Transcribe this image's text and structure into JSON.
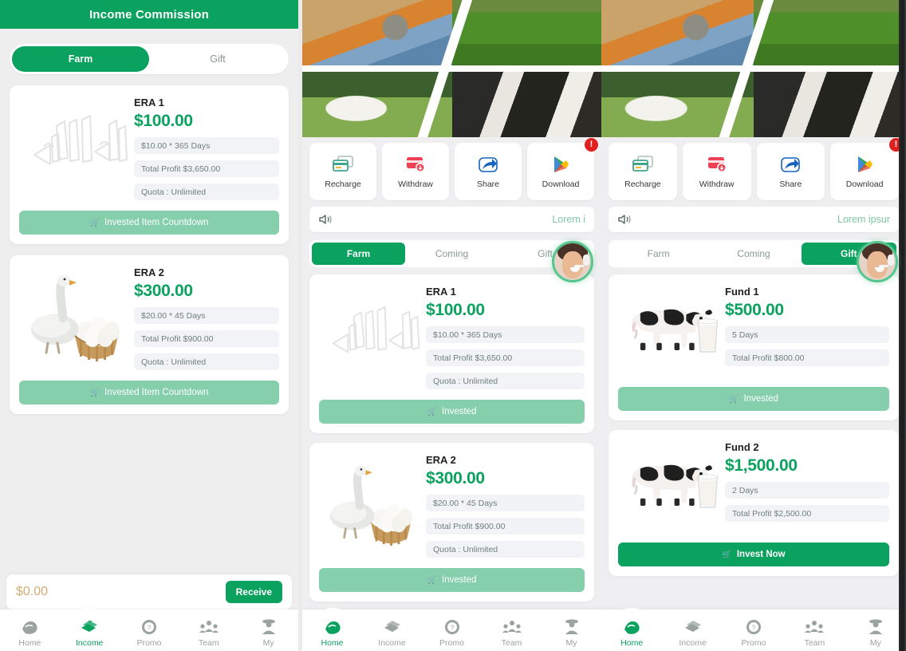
{
  "app": {
    "accent_green": "#0ba15e",
    "muted_green": "#85cfac",
    "gold": "#d2ab73",
    "badge_red": "#e01f1f"
  },
  "left_panel": {
    "header_title": "Income Commission",
    "segments": [
      {
        "label": "Farm",
        "active": true
      },
      {
        "label": "Gift",
        "active": false
      }
    ],
    "cards": [
      {
        "title": "ERA 1",
        "price": "$100.00",
        "meta": [
          "$10.00 * 365 Days",
          "Total Profit $3,650.00",
          "Quota : Unlimited"
        ],
        "cta_label": "Invested Item Countdown",
        "cta_state": "disabled",
        "art": "sketch-doodle"
      },
      {
        "title": "ERA 2",
        "price": "$300.00",
        "meta": [
          "$20.00 * 45 Days",
          "Total Profit $900.00",
          "Quota : Unlimited"
        ],
        "cta_label": "Invested Item Countdown",
        "cta_state": "disabled",
        "art": "goose-eggs"
      }
    ],
    "income_bar": {
      "amount": "$0.00",
      "receive_label": "Receive"
    },
    "tabbar": [
      {
        "label": "Home",
        "icon": "home-icon",
        "active": false
      },
      {
        "label": "Income",
        "icon": "income-icon",
        "active": true
      },
      {
        "label": "Promo",
        "icon": "promo-icon",
        "active": false
      },
      {
        "label": "Team",
        "icon": "team-icon",
        "active": false
      },
      {
        "label": "My",
        "icon": "my-icon",
        "active": false
      }
    ]
  },
  "mid_panel": {
    "quick_actions": [
      {
        "label": "Recharge",
        "icon": "recharge-card-icon",
        "badge": ""
      },
      {
        "label": "Withdraw",
        "icon": "withdraw-card-icon",
        "badge": ""
      },
      {
        "label": "Share",
        "icon": "share-arrow-icon",
        "badge": ""
      },
      {
        "label": "Download",
        "icon": "play-store-icon",
        "badge": "!"
      }
    ],
    "marquee": {
      "icon": "speaker-icon",
      "text": "Lorem i"
    },
    "tabs": [
      {
        "label": "Farm",
        "active": true
      },
      {
        "label": "Coming",
        "active": false
      },
      {
        "label": "Gift",
        "active": false
      }
    ],
    "cards": [
      {
        "title": "ERA 1",
        "price": "$100.00",
        "meta": [
          "$10.00 * 365 Days",
          "Total Profit $3,650.00",
          "Quota : Unlimited"
        ],
        "cta_label": "Invested",
        "cta_state": "disabled",
        "art": "sketch-doodle"
      },
      {
        "title": "ERA 2",
        "price": "$300.00",
        "meta": [
          "$20.00 * 45 Days",
          "Total Profit $900.00",
          "Quota : Unlimited"
        ],
        "cta_label": "Invested",
        "cta_state": "disabled",
        "art": "goose-eggs"
      }
    ],
    "tabbar": [
      {
        "label": "Home",
        "icon": "home-icon",
        "active": true
      },
      {
        "label": "Income",
        "icon": "income-icon",
        "active": false
      },
      {
        "label": "Promo",
        "icon": "promo-icon",
        "active": false
      },
      {
        "label": "Team",
        "icon": "team-icon",
        "active": false
      },
      {
        "label": "My",
        "icon": "my-icon",
        "active": false
      }
    ]
  },
  "right_panel": {
    "quick_actions": [
      {
        "label": "Recharge",
        "icon": "recharge-card-icon",
        "badge": ""
      },
      {
        "label": "Withdraw",
        "icon": "withdraw-card-icon",
        "badge": ""
      },
      {
        "label": "Share",
        "icon": "share-arrow-icon",
        "badge": ""
      },
      {
        "label": "Download",
        "icon": "play-store-icon",
        "badge": "!"
      }
    ],
    "marquee": {
      "icon": "speaker-icon",
      "text": "Lorem ipsur"
    },
    "tabs": [
      {
        "label": "Farm",
        "active": false
      },
      {
        "label": "Coming",
        "active": false
      },
      {
        "label": "Gift",
        "active": true
      }
    ],
    "cards": [
      {
        "title": "Fund 1",
        "price": "$500.00",
        "meta": [
          "5 Days",
          "Total Profit $800.00"
        ],
        "cta_label": "Invested",
        "cta_state": "disabled",
        "art": "cow-milk"
      },
      {
        "title": "Fund 2",
        "price": "$1,500.00",
        "meta": [
          "2 Days",
          "Total Profit $2,500.00"
        ],
        "cta_label": "Invest Now",
        "cta_state": "active",
        "art": "cow-milk"
      }
    ],
    "tabbar": [
      {
        "label": "Home",
        "icon": "home-icon",
        "active": true
      },
      {
        "label": "Income",
        "icon": "income-icon",
        "active": false
      },
      {
        "label": "Promo",
        "icon": "promo-icon",
        "active": false
      },
      {
        "label": "Team",
        "icon": "team-icon",
        "active": false
      },
      {
        "label": "My",
        "icon": "my-icon",
        "active": false
      }
    ]
  }
}
